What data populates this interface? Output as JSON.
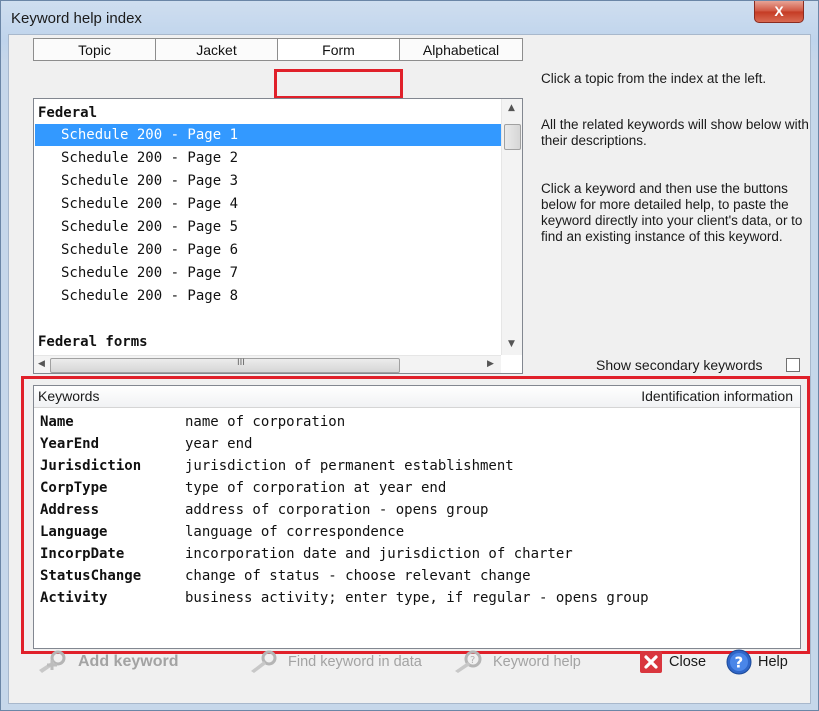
{
  "window": {
    "title": "Keyword help index",
    "close_glyph": "X"
  },
  "tabs": [
    {
      "label": "Topic"
    },
    {
      "label": "Jacket"
    },
    {
      "label": "Form"
    },
    {
      "label": "Alphabetical"
    }
  ],
  "index": {
    "groups": [
      {
        "label": "Federal"
      },
      {
        "label": "Federal forms"
      }
    ],
    "items": [
      {
        "label": "Schedule 200 - Page 1",
        "selected": true
      },
      {
        "label": "Schedule 200 - Page 2"
      },
      {
        "label": "Schedule 200 - Page 3"
      },
      {
        "label": "Schedule 200 - Page 4"
      },
      {
        "label": "Schedule 200 - Page 5"
      },
      {
        "label": "Schedule 200 - Page 6"
      },
      {
        "label": "Schedule 200 - Page 7"
      },
      {
        "label": "Schedule 200 - Page 8"
      }
    ],
    "hscroll_grip": "III"
  },
  "help": {
    "p1": "Click a topic from the index at the left.",
    "p2": "All the related keywords will show below with their descriptions.",
    "p3": "Click a keyword and then use the buttons below for more detailed help, to paste the keyword directly into your client's data, or to find an existing instance of this keyword."
  },
  "show_secondary": {
    "label": "Show secondary keywords",
    "checked": false
  },
  "keywords": {
    "header_left": "Keywords",
    "header_right": "Identification information",
    "rows": [
      {
        "name": "Name",
        "desc": "name of corporation"
      },
      {
        "name": "YearEnd",
        "desc": "year end"
      },
      {
        "name": "Jurisdiction",
        "desc": "jurisdiction of permanent establishment"
      },
      {
        "name": "CorpType",
        "desc": "type of corporation at year end"
      },
      {
        "name": "Address",
        "desc": "address of corporation - opens group"
      },
      {
        "name": "Language",
        "desc": "language of correspondence"
      },
      {
        "name": "IncorpDate",
        "desc": "incorporation date and jurisdiction of charter"
      },
      {
        "name": "StatusChange",
        "desc": "change of status - choose relevant change"
      },
      {
        "name": "Activity",
        "desc": "business activity; enter type, if regular - opens group"
      }
    ]
  },
  "buttons": {
    "add_keyword": "Add keyword",
    "find_keyword": "Find keyword in data",
    "keyword_help": "Keyword help",
    "close": "Close",
    "help": "Help"
  },
  "colors": {
    "highlight": "#e0202a",
    "selection": "#3399ff"
  }
}
